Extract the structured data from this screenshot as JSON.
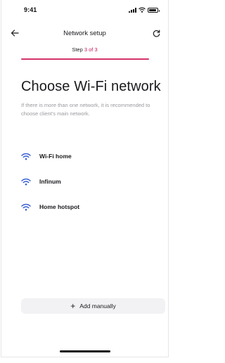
{
  "status_bar": {
    "time": "9:41"
  },
  "header": {
    "title": "Network setup",
    "back_icon": "arrow-left-icon",
    "refresh_icon": "refresh-icon"
  },
  "step": {
    "prefix": "Step",
    "current": "3 of 3",
    "progress_fraction": 1.0
  },
  "main": {
    "title": "Choose Wi-Fi network",
    "description": "If there is more than one network, it is recommended to choose client's main network."
  },
  "networks": [
    {
      "name": "Wi-Fi home",
      "icon": "wifi-icon"
    },
    {
      "name": "Infinum",
      "icon": "wifi-icon"
    },
    {
      "name": "Home hotspot",
      "icon": "wifi-icon"
    }
  ],
  "add_manually": {
    "icon": "plus-icon",
    "label": "Add manually"
  },
  "colors": {
    "accent": "#d6336c",
    "step_highlight": "#c2185b",
    "wifi_icon": "#3b62d6",
    "button_bg": "#f2f2f4"
  }
}
